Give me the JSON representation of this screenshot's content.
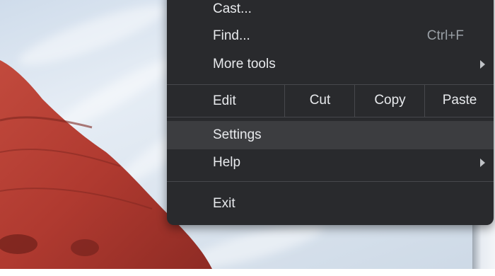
{
  "menu": {
    "items_top": [
      {
        "label": "Cast...",
        "shortcut": ""
      },
      {
        "label": "Find...",
        "shortcut": "Ctrl+F"
      },
      {
        "label": "More tools",
        "shortcut": ""
      }
    ],
    "edit": {
      "label": "Edit",
      "cut": "Cut",
      "copy": "Copy",
      "paste": "Paste"
    },
    "settings": "Settings",
    "help": "Help",
    "exit": "Exit"
  },
  "colors": {
    "menu_bg": "#292a2d",
    "hover_bg": "#3c3d40",
    "text": "#e8eaed",
    "rock": "#b23d33"
  }
}
